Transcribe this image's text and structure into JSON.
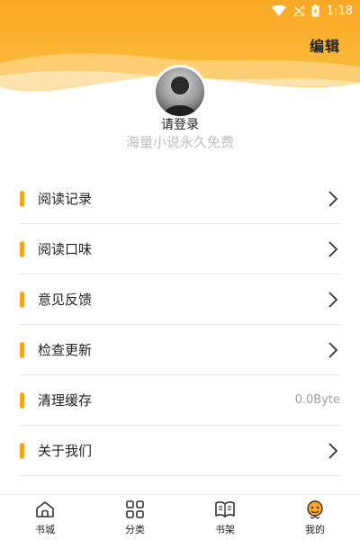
{
  "status_bar": {
    "time": "1:18"
  },
  "header": {
    "edit_label": "编辑",
    "accent_color": "#f9a825"
  },
  "profile": {
    "login_text": "请登录",
    "slogan": "海量小说永久免费"
  },
  "menu": [
    {
      "label": "阅读记录",
      "has_arrow": true
    },
    {
      "label": "阅读口味",
      "has_arrow": true
    },
    {
      "label": "意见反馈",
      "has_arrow": true
    },
    {
      "label": "检查更新",
      "has_arrow": true
    },
    {
      "label": "清理缓存",
      "value": "0.0Byte"
    },
    {
      "label": "关于我们",
      "has_arrow": true
    }
  ],
  "tabs": [
    {
      "label": "书城",
      "icon": "home-icon"
    },
    {
      "label": "分类",
      "icon": "grid-icon"
    },
    {
      "label": "书架",
      "icon": "book-icon"
    },
    {
      "label": "我的",
      "icon": "profile-icon"
    }
  ]
}
